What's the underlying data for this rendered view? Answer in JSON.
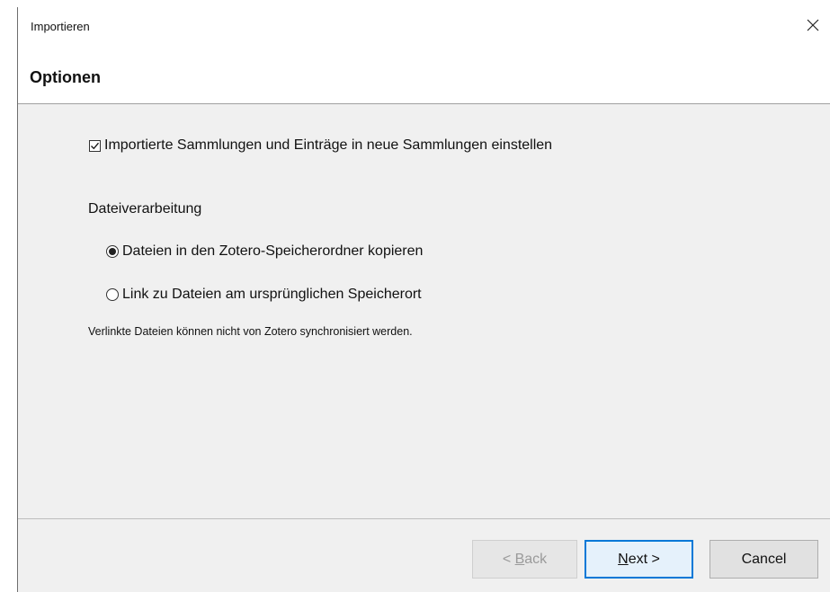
{
  "window": {
    "title": "Importieren"
  },
  "header": {
    "title": "Optionen"
  },
  "options": {
    "collections_checkbox": {
      "label": "Importierte Sammlungen und Einträge in neue Sammlungen einstellen",
      "checked": true
    },
    "file_handling_label": "Dateiverarbeitung",
    "radio_copy": {
      "label": "Dateien in den Zotero-Speicherordner kopieren",
      "selected": true
    },
    "radio_link": {
      "label": "Link zu Dateien am ursprünglichen Speicherort",
      "selected": false
    },
    "note": "Verlinkte Dateien können nicht von Zotero synchronisiert werden."
  },
  "buttons": {
    "back": {
      "prefix": "< ",
      "accel": "B",
      "rest": "ack",
      "enabled": false
    },
    "next": {
      "accel": "N",
      "rest": "ext >"
    },
    "cancel": {
      "label": "Cancel"
    }
  },
  "icons": {
    "close": "close-icon",
    "checkbox": "checkmark-icon",
    "radio": "radio-dot-icon"
  }
}
